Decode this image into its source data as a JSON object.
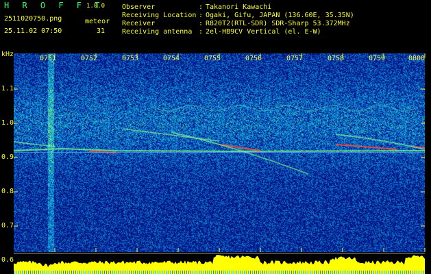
{
  "header": {
    "app_title": "H R O F F T",
    "app_version": "1.0.0",
    "file_name": "2511020750.png",
    "meteor_label": "meteor",
    "datetime": "25.11.02 07:50",
    "meteor_count": "31"
  },
  "info": {
    "rows": [
      {
        "key": "Observer",
        "value": "Takanori Kawachi"
      },
      {
        "key": "Receiving Location",
        "value": "Ogaki, Gifu, JAPAN (136.60E, 35.35N)"
      },
      {
        "key": "Receiver",
        "value": "R820T2(RTL-SDR) SDR-Sharp 53.372MHz"
      },
      {
        "key": "Receiving antenna",
        "value": "2el-HB9CV Vertical (el. E-W)"
      }
    ]
  },
  "axis": {
    "y_unit": "kHz",
    "y_ticks": [
      "1.1",
      "1.0",
      "0.9",
      "0.8",
      "0.7",
      "0.6"
    ],
    "x_ticks": [
      "0751",
      "0752",
      "0753",
      "0754",
      "0755",
      "0756",
      "0757",
      "0758",
      "0759",
      "0800"
    ]
  },
  "colors": {
    "background": "#000000",
    "spectrogram_base": "#0a1a8a",
    "header_yellow": "#ffff33",
    "header_green": "#33ff66",
    "activity_bar": "#ffff00"
  }
}
